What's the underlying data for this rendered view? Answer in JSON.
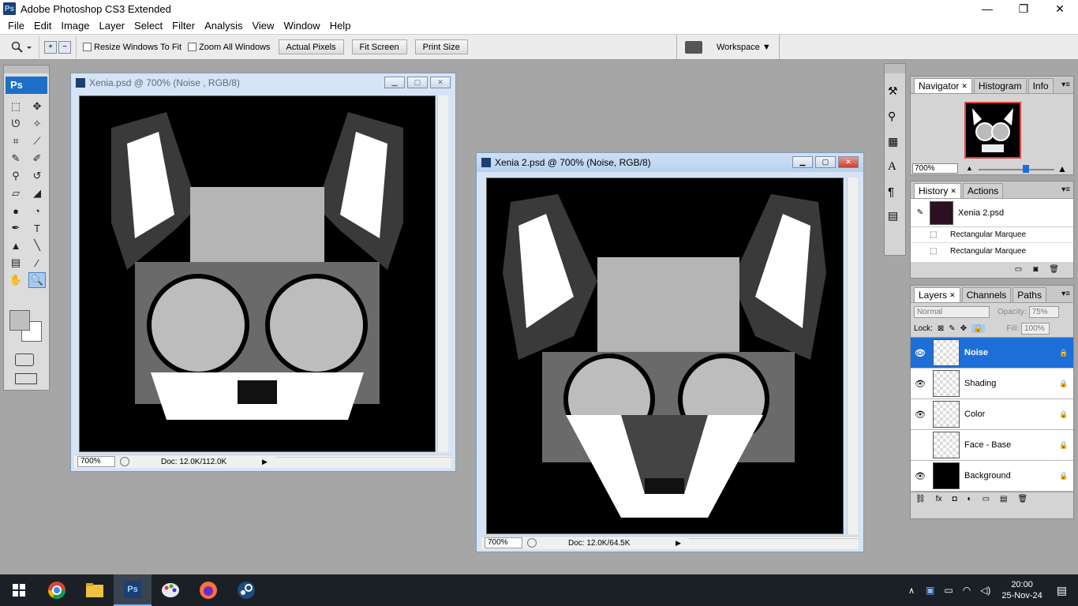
{
  "app": {
    "title": "Adobe Photoshop CS3 Extended",
    "logo": "Ps"
  },
  "window_controls": {
    "minimize": "—",
    "restore": "❐",
    "close": "✕"
  },
  "menu": [
    "File",
    "Edit",
    "Image",
    "Layer",
    "Select",
    "Filter",
    "Analysis",
    "View",
    "Window",
    "Help"
  ],
  "options": {
    "resize_windows": "Resize Windows To Fit",
    "zoom_all": "Zoom All Windows",
    "actual_pixels": "Actual Pixels",
    "fit_screen": "Fit Screen",
    "print_size": "Print Size",
    "workspace": "Workspace ▼"
  },
  "toolbox": {
    "header": "Ps",
    "tools": [
      "marquee-icon",
      "move-icon",
      "lasso-icon",
      "magic-wand-icon",
      "crop-icon",
      "slice-icon",
      "healing-brush-icon",
      "brush-icon",
      "clone-stamp-icon",
      "history-brush-icon",
      "eraser-icon",
      "paint-bucket-icon",
      "blur-icon",
      "dodge-icon",
      "pen-icon",
      "type-icon",
      "path-select-icon",
      "line-icon",
      "notes-icon",
      "eyedropper-icon",
      "hand-icon",
      "zoom-icon"
    ],
    "tool_glyphs": [
      "⬚",
      "✥",
      "ᘎ",
      "✧",
      "⌗",
      "⟋",
      "✎",
      "✐",
      "⚲",
      "↺",
      "▱",
      "◢",
      "●",
      "◔",
      "✒",
      "T",
      "▲",
      "╲",
      "▤",
      "⁄",
      "✋",
      "🔍"
    ],
    "fg_color": "#c0c0c0",
    "bg_color": "#ffffff"
  },
  "doc1": {
    "title": "Xenia.psd @ 700% (Noise , RGB/8)",
    "zoom": "700%",
    "docsize": "Doc: 12.0K/112.0K"
  },
  "doc2": {
    "title": "Xenia 2.psd @ 700% (Noise, RGB/8)",
    "zoom": "700%",
    "docsize": "Doc: 12.0K/64.5K"
  },
  "navigator": {
    "tabs": [
      "Navigator",
      "Histogram",
      "Info"
    ],
    "zoom": "700%"
  },
  "history": {
    "tabs": [
      "History",
      "Actions"
    ],
    "snapshot": "Xenia 2.psd",
    "items": [
      "Rectangular Marquee",
      "Rectangular Marquee"
    ]
  },
  "layers": {
    "tabs": [
      "Layers",
      "Channels",
      "Paths"
    ],
    "blend": "Normal",
    "opacity_label": "Opacity:",
    "opacity": "75%",
    "lock_label": "Lock:",
    "fill_label": "Fill:",
    "fill": "100%",
    "rows": [
      {
        "name": "Noise",
        "visible": true,
        "selected": true
      },
      {
        "name": "Shading",
        "visible": true,
        "selected": false
      },
      {
        "name": "Color",
        "visible": true,
        "selected": false
      },
      {
        "name": "Face - Base",
        "visible": false,
        "selected": false
      },
      {
        "name": "Background",
        "visible": true,
        "selected": false
      }
    ]
  },
  "taskbar": {
    "time": "20:00",
    "date": "25-Nov-24",
    "apps": [
      "windows-start-icon",
      "chrome-icon",
      "file-explorer-icon",
      "photoshop-icon",
      "paint-icon",
      "firefox-icon",
      "steam-icon"
    ]
  }
}
